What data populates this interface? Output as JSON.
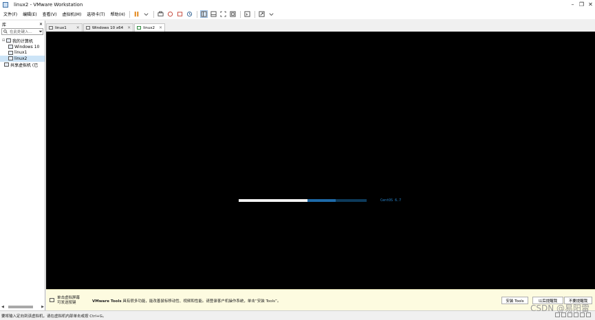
{
  "window": {
    "title": "linux2 - VMware Workstation",
    "minimize_glyph": "–",
    "maximize_glyph": "❐",
    "close_glyph": "✕"
  },
  "menu": {
    "items": [
      "文件(F)",
      "编辑(E)",
      "查看(V)",
      "虚拟机(M)",
      "选项卡(T)",
      "帮助(H)"
    ]
  },
  "sidebar": {
    "title": "库",
    "close_glyph": "✕",
    "search_placeholder": "在此处键入...",
    "tree": [
      {
        "label": "我的计算机",
        "level": 0,
        "expanded": true
      },
      {
        "label": "Windows 10",
        "level": 1
      },
      {
        "label": "linux1",
        "level": 1
      },
      {
        "label": "linux2",
        "level": 1,
        "selected": true
      },
      {
        "label": "共享虚拟机 (已",
        "level": 0
      }
    ]
  },
  "tabs": [
    {
      "label": "linux1",
      "active": false
    },
    {
      "label": "Windows 10 x64",
      "active": false
    },
    {
      "label": "linux2",
      "active": true
    }
  ],
  "vm_screen": {
    "boot_progress_white": 0.54,
    "boot_progress_blue": 0.76,
    "os_label": "CentOS 6.7"
  },
  "notice": {
    "hint_line1": "单击虚拟屏幕",
    "hint_line2": "可发送按键",
    "message_bold": "VMware Tools",
    "message_rest": " 具有很多功能，能改善鼠标移动性、视频和性能。请登录客户机操作系统，单击“安装 Tools”。",
    "install_button": "安装 Tools",
    "later_button": "以后提醒我",
    "never_button": "不要提醒我"
  },
  "status": {
    "text": "要将输入定向到该虚拟机，请在虚拟机内部单击或按 Ctrl+G。"
  },
  "watermark": "CSDN @易阳雷",
  "colors": {
    "vm_background": "#000000",
    "progress_blue": "#1e6aa8",
    "notice_background": "#fdfbe0"
  }
}
